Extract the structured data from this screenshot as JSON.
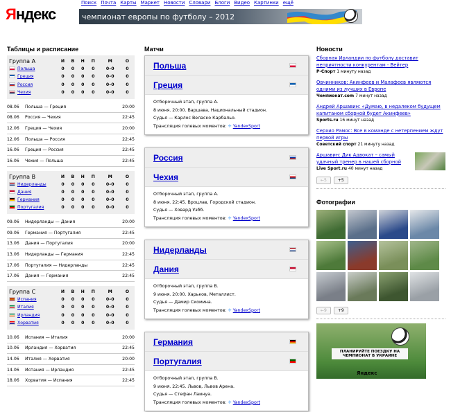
{
  "header": {
    "logo_first": "Я",
    "logo_rest": "ндекс",
    "nav": [
      "Поиск",
      "Почта",
      "Карты",
      "Маркет",
      "Новости",
      "Словари",
      "Блоги",
      "Видео",
      "Картинки",
      "ещё"
    ],
    "banner_text": "чемпионат европы по футболу – 2012"
  },
  "sections": {
    "tables_title": "Таблицы и расписание",
    "matches_title": "Матчи",
    "news_title": "Новости",
    "photos_title": "Фотографии"
  },
  "groups": [
    {
      "name": "Группа А",
      "cols": [
        "И",
        "В",
        "Н",
        "П",
        "М",
        "О"
      ],
      "teams": [
        {
          "name": "Польша",
          "flag": [
            "#fff",
            "#dc143c"
          ],
          "stats": [
            "0",
            "0",
            "0",
            "0",
            "0–0",
            "0"
          ]
        },
        {
          "name": "Греция",
          "flag": [
            "#0d5eaf",
            "#fff"
          ],
          "stats": [
            "0",
            "0",
            "0",
            "0",
            "0–0",
            "0"
          ]
        },
        {
          "name": "Россия",
          "flag": [
            "#fff",
            "#0039a6",
            "#d52b1e"
          ],
          "stats": [
            "0",
            "0",
            "0",
            "0",
            "0–0",
            "0"
          ]
        },
        {
          "name": "Чехия",
          "flag": [
            "#fff",
            "#d7141a",
            "#11457e"
          ],
          "stats": [
            "0",
            "0",
            "0",
            "0",
            "0–0",
            "0"
          ]
        }
      ],
      "schedule": [
        {
          "date": "08.06",
          "match": "Польша — Греция",
          "time": "20:00"
        },
        {
          "date": "08.06",
          "match": "Россия — Чехия",
          "time": "22:45"
        },
        {
          "date": "12.06",
          "match": "Греция — Чехия",
          "time": "20:00"
        },
        {
          "date": "12.06",
          "match": "Польша — Россия",
          "time": "22:45"
        },
        {
          "date": "16.06",
          "match": "Греция — Россия",
          "time": "22:45"
        },
        {
          "date": "16.06",
          "match": "Чехия — Польша",
          "time": "22:45"
        }
      ]
    },
    {
      "name": "Группа В",
      "cols": [
        "И",
        "В",
        "Н",
        "П",
        "М",
        "О"
      ],
      "teams": [
        {
          "name": "Нидерланды",
          "flag": [
            "#ae1c28",
            "#fff",
            "#21468b"
          ],
          "stats": [
            "0",
            "0",
            "0",
            "0",
            "0–0",
            "0"
          ]
        },
        {
          "name": "Дания",
          "flag": [
            "#c60c30",
            "#fff"
          ],
          "stats": [
            "0",
            "0",
            "0",
            "0",
            "0–0",
            "0"
          ]
        },
        {
          "name": "Германия",
          "flag": [
            "#000",
            "#dd0000",
            "#ffce00"
          ],
          "stats": [
            "0",
            "0",
            "0",
            "0",
            "0–0",
            "0"
          ]
        },
        {
          "name": "Португалия",
          "flag": [
            "#006600",
            "#ff0000"
          ],
          "stats": [
            "0",
            "0",
            "0",
            "0",
            "0–0",
            "0"
          ]
        }
      ],
      "schedule": [
        {
          "date": "09.06",
          "match": "Нидерланды — Дания",
          "time": "20:00"
        },
        {
          "date": "09.06",
          "match": "Германия — Португалия",
          "time": "22:45"
        },
        {
          "date": "13.06",
          "match": "Дания — Португалия",
          "time": "20:00"
        },
        {
          "date": "13.06",
          "match": "Нидерланды — Германия",
          "time": "22:45"
        },
        {
          "date": "17.06",
          "match": "Португалия — Нидерланды",
          "time": "22:45"
        },
        {
          "date": "17.06",
          "match": "Дания — Германия",
          "time": "22:45"
        }
      ]
    },
    {
      "name": "Группа С",
      "cols": [
        "И",
        "В",
        "Н",
        "П",
        "М",
        "О"
      ],
      "teams": [
        {
          "name": "Испания",
          "flag": [
            "#aa151b",
            "#f1bf00",
            "#aa151b"
          ],
          "stats": [
            "0",
            "0",
            "0",
            "0",
            "0–0",
            "0"
          ]
        },
        {
          "name": "Италия",
          "flag": [
            "#009246",
            "#fff",
            "#ce2b37"
          ],
          "stats": [
            "0",
            "0",
            "0",
            "0",
            "0–0",
            "0"
          ]
        },
        {
          "name": "Ирландия",
          "flag": [
            "#169b62",
            "#fff",
            "#ff883e"
          ],
          "stats": [
            "0",
            "0",
            "0",
            "0",
            "0–0",
            "0"
          ]
        },
        {
          "name": "Хорватия",
          "flag": [
            "#ff0000",
            "#fff",
            "#171796"
          ],
          "stats": [
            "0",
            "0",
            "0",
            "0",
            "0–0",
            "0"
          ]
        }
      ],
      "schedule": [
        {
          "date": "10.06",
          "match": "Испания — Италия",
          "time": "20:00"
        },
        {
          "date": "10.06",
          "match": "Ирландия — Хорватия",
          "time": "22:45"
        },
        {
          "date": "14.06",
          "match": "Италия — Хорватия",
          "time": "20:00"
        },
        {
          "date": "14.06",
          "match": "Испания — Ирландия",
          "time": "22:45"
        },
        {
          "date": "18.06",
          "match": "Хорватия — Испания",
          "time": "22:45"
        }
      ]
    }
  ],
  "matches": [
    {
      "team1": "Польша",
      "flag1": [
        "#fff",
        "#dc143c"
      ],
      "team2": "Греция",
      "flag2": [
        "#0d5eaf",
        "#fff"
      ],
      "stage": "Отборочный этап, группа А.",
      "when": "8 июня. 20:00. Варшава, Национальный стадион.",
      "referee": "Судья — Карлос Веласко Карбальо.",
      "stream_label": "Трансляция голевых моментов:",
      "stream_link": "YandexSport"
    },
    {
      "team1": "Россия",
      "flag1": [
        "#fff",
        "#0039a6",
        "#d52b1e"
      ],
      "team2": "Чехия",
      "flag2": [
        "#fff",
        "#d7141a",
        "#11457e"
      ],
      "stage": "Отборочный этап, группа А.",
      "when": "8 июня. 22:45. Вроцлав, Городской стадион.",
      "referee": "Судья — Ховард Уэбб.",
      "stream_label": "Трансляция голевых моментов:",
      "stream_link": "YandexSport"
    },
    {
      "team1": "Нидерланды",
      "flag1": [
        "#ae1c28",
        "#fff",
        "#21468b"
      ],
      "team2": "Дания",
      "flag2": [
        "#c60c30",
        "#fff"
      ],
      "stage": "Отборочный этап, группа В.",
      "when": "9 июня. 20:00. Харьков, Металлист.",
      "referee": "Судья — Дамир Скомина.",
      "stream_label": "Трансляция голевых моментов:",
      "stream_link": "YandexSport"
    },
    {
      "team1": "Германия",
      "flag1": [
        "#000",
        "#dd0000",
        "#ffce00"
      ],
      "team2": "Португалия",
      "flag2": [
        "#006600",
        "#ff0000"
      ],
      "stage": "Отборочный этап, группа В.",
      "when": "9 июня. 22:45. Львов, Львов Арена.",
      "referee": "Судья — Стефан Лаинуа.",
      "stream_label": "Трансляция голевых моментов:",
      "stream_link": "YandexSport"
    }
  ],
  "news": [
    {
      "title": "Сборная Ирландии по футболу доставит неприятности конкурентам - Вейтер",
      "source": "Р-Спорт",
      "ago": "1 минуту назад"
    },
    {
      "title": "Овчинников: Акинфеев и Малафеев являются одними из лучших в Европе",
      "source": "Чемпионат.com",
      "ago": "7 минут назад"
    },
    {
      "title": "Андрей Аршавин: «Думаю, в недалеком будущем капитаном сборной будет Акинфеев»",
      "source": "Sports.ru",
      "ago": "16 минут назад"
    },
    {
      "title": "Серхио Рамос: Все в команде с нетерпением ждут первой игры",
      "source": "Советский спорт",
      "ago": "21 минуту назад"
    },
    {
      "title": "Аршавин: Дик Адвокат – самый удачный тренер в нашей сборной",
      "source": "Live Sport.ru",
      "ago": "40 минут назад"
    }
  ],
  "news_pager": {
    "prev": "←5",
    "next": "+5"
  },
  "photos_pager": {
    "prev": "←9",
    "next": "+9"
  },
  "ad": {
    "text": "ПЛАНИРУЙТЕ ПОЕЗДКУ НА ЧЕМПИОНАТ В УКРАИНЕ",
    "logo": "Яндекс"
  },
  "colors": {
    "link": "#0000cc",
    "logo_red": "#ff0000"
  }
}
